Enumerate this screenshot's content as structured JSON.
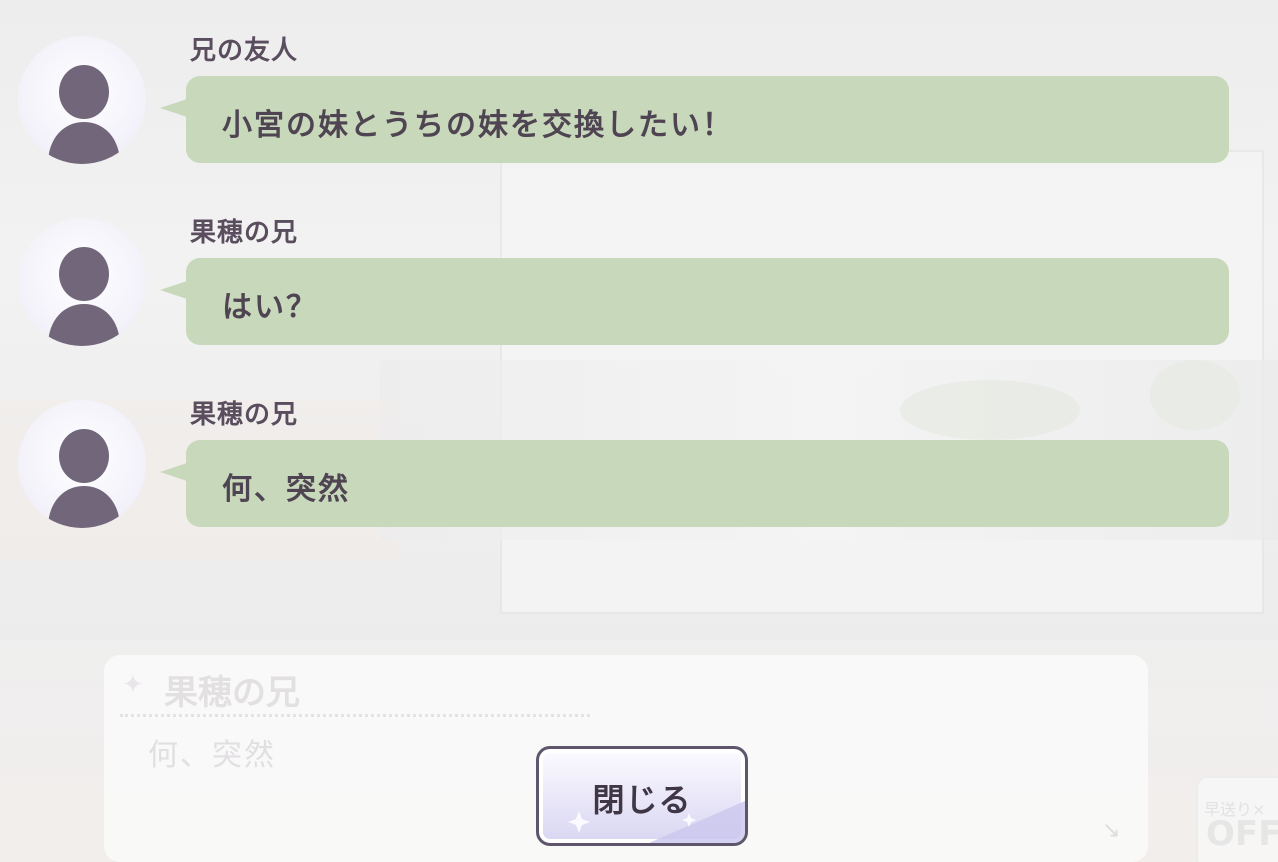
{
  "log": [
    {
      "speaker": "兄の友人",
      "message": "小宮の妹とうちの妹を交換したい！"
    },
    {
      "speaker": "果穂の兄",
      "message": "はい？"
    },
    {
      "speaker": "果穂の兄",
      "message": "何、突然"
    }
  ],
  "dialogue": {
    "speaker": "果穂の兄",
    "text": "何、突然"
  },
  "fast_forward": {
    "label": "早送り×",
    "value": "OFF"
  },
  "close_button": {
    "label": "閉じる"
  },
  "colors": {
    "bubble": "#c8d8bb",
    "avatar_silhouette": "#72677a",
    "button_border": "#5e566a"
  }
}
